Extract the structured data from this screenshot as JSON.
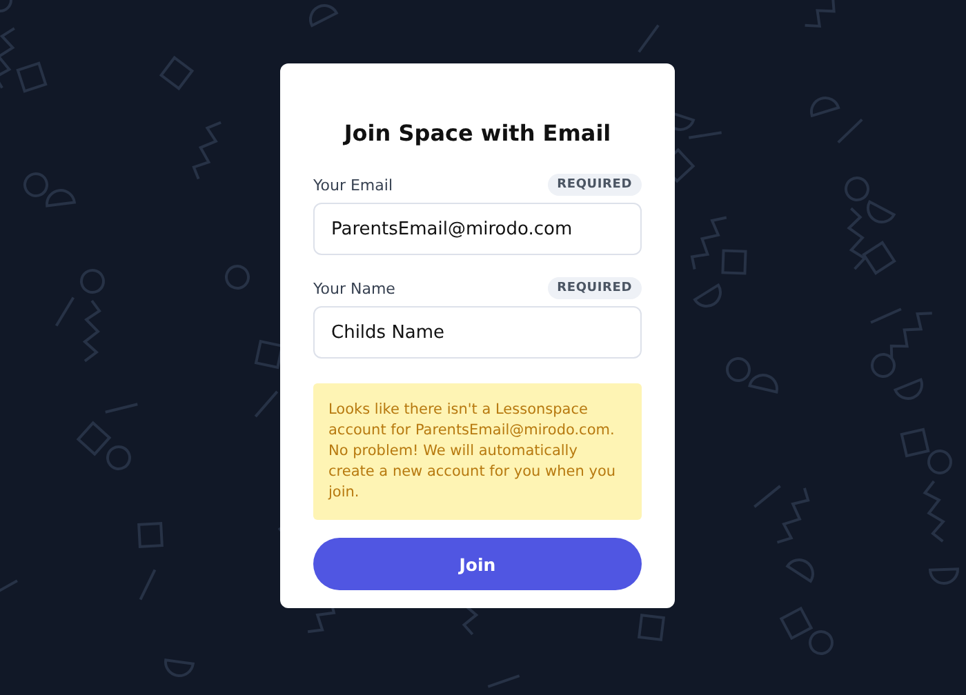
{
  "dialog": {
    "title": "Join Space with Email",
    "fields": [
      {
        "label": "Your Email",
        "badge": "REQUIRED",
        "value": "ParentsEmail@mirodo.com"
      },
      {
        "label": "Your Name",
        "badge": "REQUIRED",
        "value": "Childs Name"
      }
    ],
    "notice": "Looks like there isn't a Lessonspace account for ParentsEmail@mirodo.com. No problem! We will automatically create a new account for you when you join.",
    "button": "Join"
  }
}
